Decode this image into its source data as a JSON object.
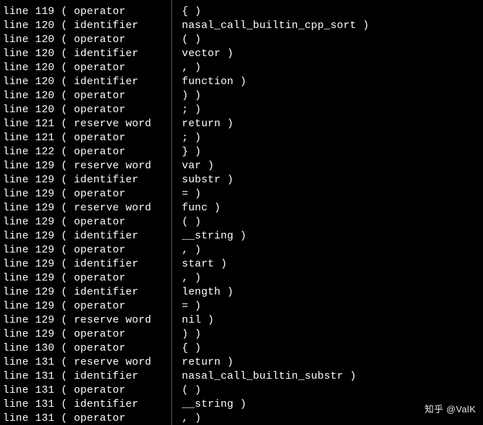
{
  "watermark": "知乎 @ValK",
  "tokens": [
    {
      "line": 119,
      "type": "operator",
      "value": "{"
    },
    {
      "line": 120,
      "type": "identifier",
      "value": "nasal_call_builtin_cpp_sort"
    },
    {
      "line": 120,
      "type": "operator",
      "value": "("
    },
    {
      "line": 120,
      "type": "identifier",
      "value": "vector"
    },
    {
      "line": 120,
      "type": "operator",
      "value": ","
    },
    {
      "line": 120,
      "type": "identifier",
      "value": "function"
    },
    {
      "line": 120,
      "type": "operator",
      "value": ")"
    },
    {
      "line": 120,
      "type": "operator",
      "value": ";"
    },
    {
      "line": 121,
      "type": "reserve word",
      "value": "return"
    },
    {
      "line": 121,
      "type": "operator",
      "value": ";"
    },
    {
      "line": 122,
      "type": "operator",
      "value": "}"
    },
    {
      "line": 129,
      "type": "reserve word",
      "value": "var"
    },
    {
      "line": 129,
      "type": "identifier",
      "value": "substr"
    },
    {
      "line": 129,
      "type": "operator",
      "value": "="
    },
    {
      "line": 129,
      "type": "reserve word",
      "value": "func"
    },
    {
      "line": 129,
      "type": "operator",
      "value": "("
    },
    {
      "line": 129,
      "type": "identifier",
      "value": "__string"
    },
    {
      "line": 129,
      "type": "operator",
      "value": ","
    },
    {
      "line": 129,
      "type": "identifier",
      "value": "start"
    },
    {
      "line": 129,
      "type": "operator",
      "value": ","
    },
    {
      "line": 129,
      "type": "identifier",
      "value": "length"
    },
    {
      "line": 129,
      "type": "operator",
      "value": "="
    },
    {
      "line": 129,
      "type": "reserve word",
      "value": "nil"
    },
    {
      "line": 129,
      "type": "operator",
      "value": ")"
    },
    {
      "line": 130,
      "type": "operator",
      "value": "{"
    },
    {
      "line": 131,
      "type": "reserve word",
      "value": "return"
    },
    {
      "line": 131,
      "type": "identifier",
      "value": "nasal_call_builtin_substr"
    },
    {
      "line": 131,
      "type": "operator",
      "value": "("
    },
    {
      "line": 131,
      "type": "identifier",
      "value": "__string"
    },
    {
      "line": 131,
      "type": "operator",
      "value": ","
    }
  ]
}
